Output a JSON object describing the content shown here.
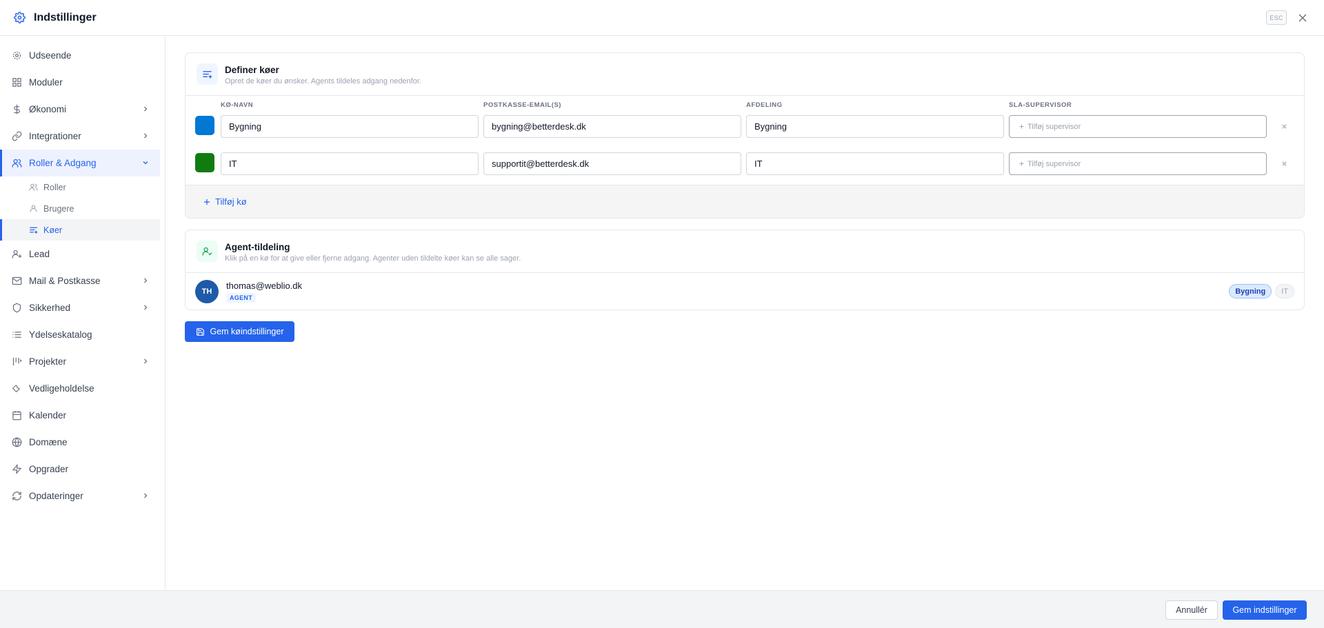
{
  "header": {
    "title": "Indstillinger",
    "esc_label": "ESC"
  },
  "sidebar": {
    "items": [
      {
        "label": "Udseende"
      },
      {
        "label": "Moduler"
      },
      {
        "label": "Økonomi"
      },
      {
        "label": "Integrationer"
      },
      {
        "label": "Roller & Adgang"
      },
      {
        "label": "Lead"
      },
      {
        "label": "Mail & Postkasse"
      },
      {
        "label": "Sikkerhed"
      },
      {
        "label": "Ydelseskatalog"
      },
      {
        "label": "Projekter"
      },
      {
        "label": "Vedligeholdelse"
      },
      {
        "label": "Kalender"
      },
      {
        "label": "Domæne"
      },
      {
        "label": "Opgrader"
      },
      {
        "label": "Opdateringer"
      }
    ],
    "sub_items": [
      {
        "label": "Roller"
      },
      {
        "label": "Brugere"
      },
      {
        "label": "Køer"
      }
    ]
  },
  "queues": {
    "title": "Definer køer",
    "subtitle": "Opret de køer du ønsker. Agents tildeles adgang nedenfor.",
    "columns": [
      "KØ-NAVN",
      "POSTKASSE-EMAIL(S)",
      "AFDELING",
      "SLA-SUPERVISOR"
    ],
    "rows": [
      {
        "color": "#0078d4",
        "name": "Bygning",
        "email": "bygning@betterdesk.dk",
        "department": "Bygning",
        "supervisor_placeholder": "Tilføj supervisor"
      },
      {
        "color": "#107c10",
        "name": "IT",
        "email": "supportit@betterdesk.dk",
        "department": "IT",
        "supervisor_placeholder": "Tilføj supervisor"
      }
    ],
    "add_label": "Tilføj kø"
  },
  "agents": {
    "title": "Agent-tildeling",
    "subtitle": "Klik på en kø for at give eller fjerne adgang. Agenter uden tildelte køer kan se alle sager.",
    "list": [
      {
        "initials": "TH",
        "email": "thomas@weblio.dk",
        "role": "AGENT",
        "queues": [
          "Bygning",
          "IT"
        ]
      }
    ]
  },
  "save_queues_label": "Gem køindstillinger",
  "footer": {
    "cancel_label": "Annullér",
    "save_label": "Gem indstillinger"
  },
  "colors": {
    "accent": "#2563eb",
    "avatar": "#1e5aa8"
  }
}
